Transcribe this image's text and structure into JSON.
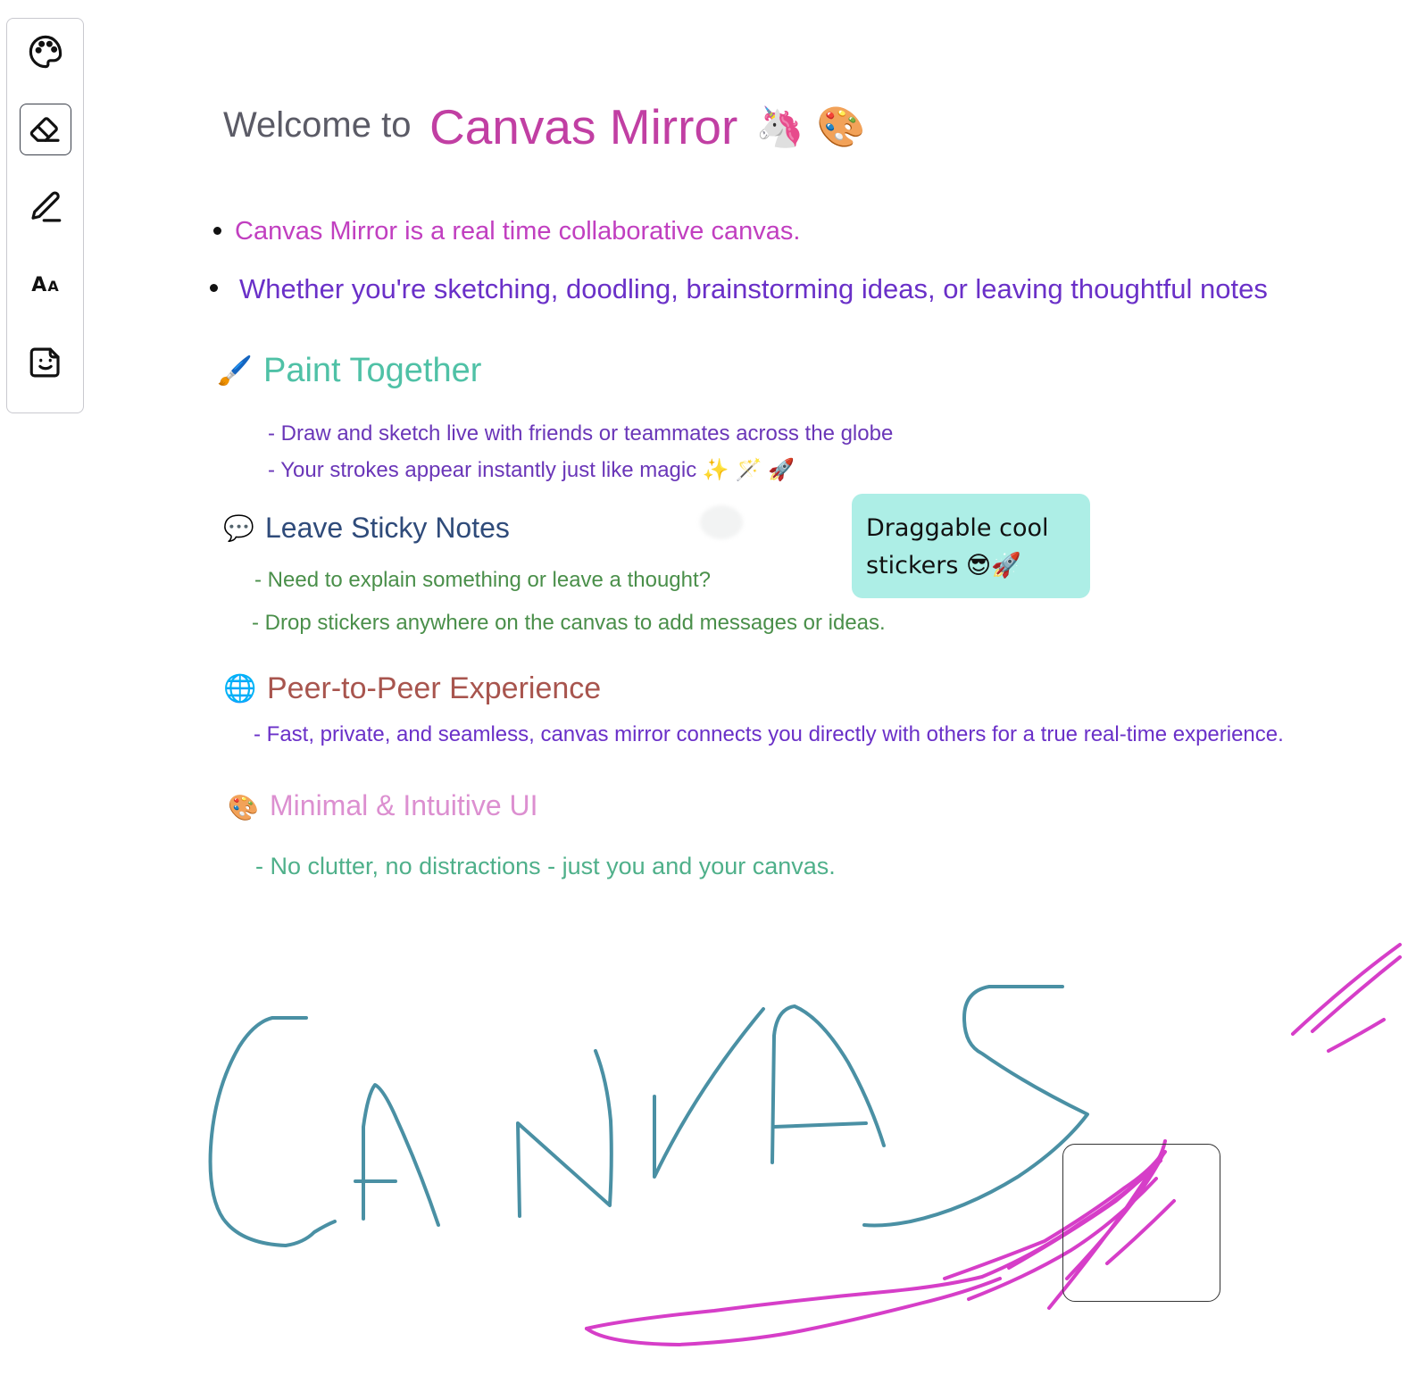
{
  "toolbar": {
    "tools": [
      {
        "name": "palette",
        "icon": "palette-icon"
      },
      {
        "name": "eraser",
        "icon": "eraser-icon",
        "active": true
      },
      {
        "name": "pen",
        "icon": "pen-icon"
      },
      {
        "name": "text",
        "icon": "text-icon",
        "label_big": "A",
        "label_small": "A"
      },
      {
        "name": "sticker",
        "icon": "sticker-icon"
      }
    ]
  },
  "canvas": {
    "welcome_prefix": "Welcome to",
    "welcome_title": "Canvas Mirror",
    "welcome_emoji": "🦄 🎨",
    "bullets": [
      "Canvas Mirror is a real time collaborative canvas.",
      "Whether you're sketching, doodling, brainstorming ideas, or leaving thoughtful notes"
    ],
    "sections": {
      "paint": {
        "emoji": "🖌️",
        "title": "Paint Together",
        "lines": [
          "- Draw and sketch live with friends or teammates across the globe",
          "- Your strokes appear instantly just like magic ✨ 🪄 🚀"
        ]
      },
      "sticky": {
        "emoji": "💬",
        "title": "Leave Sticky Notes",
        "lines": [
          "- Need to explain something or leave a thought?",
          "- Drop stickers anywhere on the canvas to add messages or ideas."
        ]
      },
      "p2p": {
        "emoji": "🌐",
        "title": "Peer-to-Peer Experience",
        "lines": [
          "- Fast, private, and seamless, canvas mirror connects you directly with others for a true real-time experience."
        ]
      },
      "ui": {
        "emoji": "🎨",
        "title": "Minimal & Intuitive UI",
        "lines": [
          "-  No clutter, no distractions - just you and your canvas."
        ]
      }
    },
    "sticker_note": {
      "text": "Draggable cool stickers 😎🚀"
    },
    "drawing_word": "CANVAS"
  },
  "colors": {
    "title_pink": "#c13fa3",
    "stroke_teal": "#4a90a4",
    "stroke_magenta": "#d63ec8",
    "sticker_bg": "#adeee6"
  }
}
